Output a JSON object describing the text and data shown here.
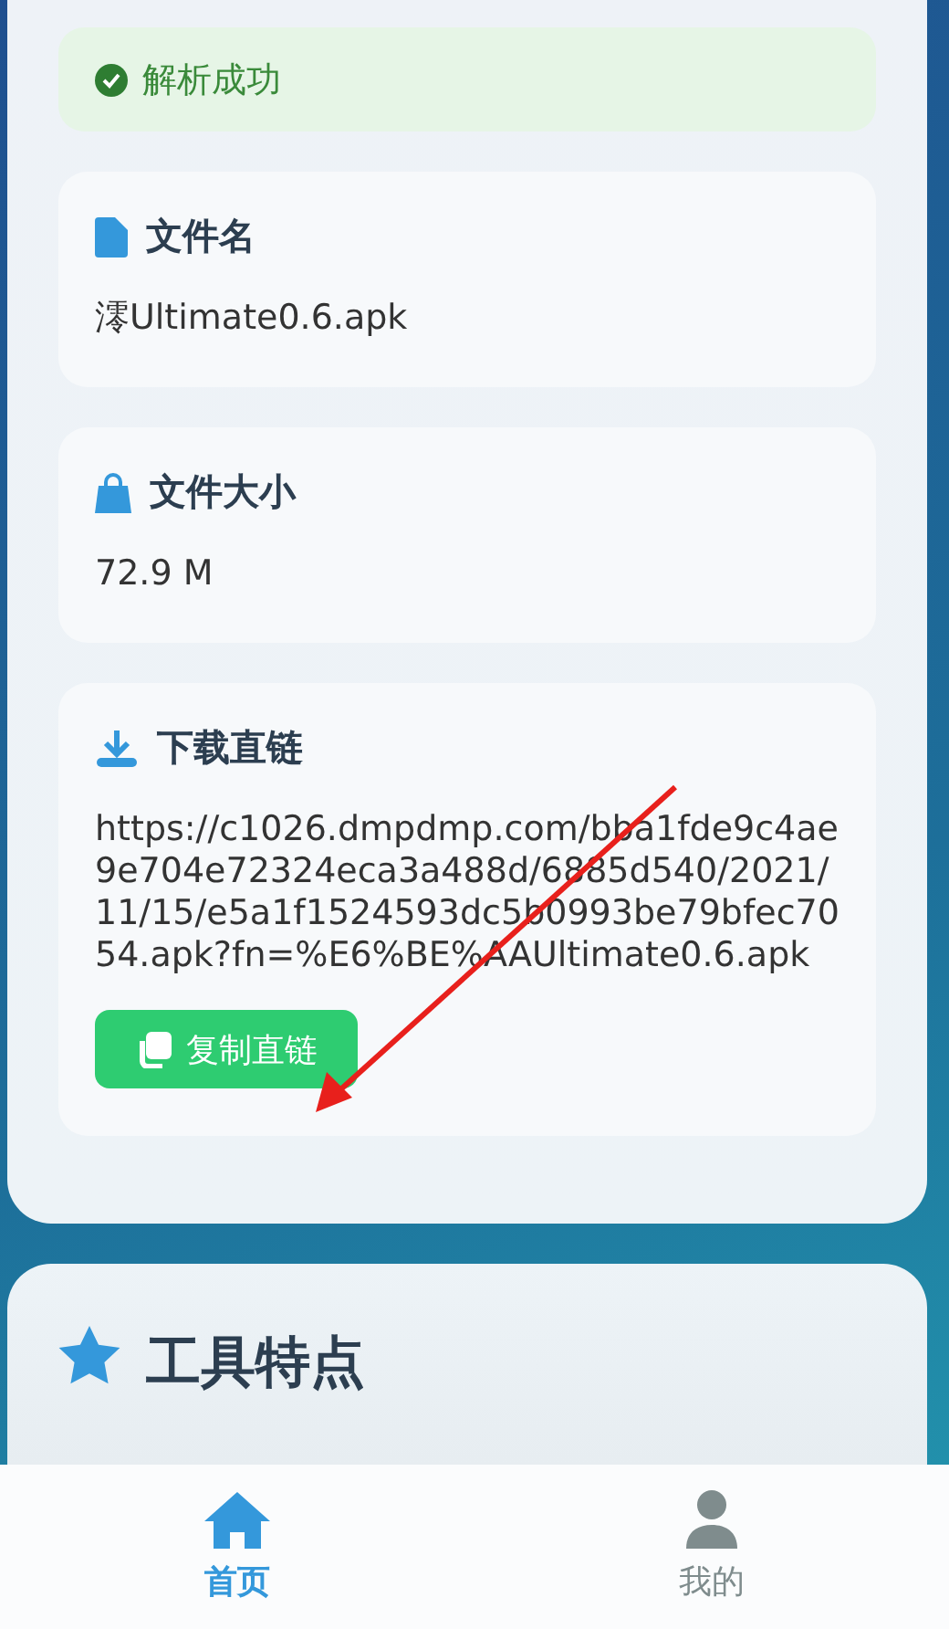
{
  "status": {
    "text": "解析成功"
  },
  "cards": [
    {
      "kind": "file",
      "title": "文件名",
      "value": "澪Ultimate0.6.apk"
    },
    {
      "kind": "size",
      "title": "文件大小",
      "value": "72.9 M"
    },
    {
      "kind": "download",
      "title": "下载直链",
      "value": "https://c1026.dmpdmp.com/bba1fde9c4ae9e704e72324eca3a488d/6885d540/2021/11/15/e5a1f1524593dc5b0993be79bfec7054.apk?fn=%E6%BE%AAUltimate0.6.apk",
      "button": "复制直链"
    }
  ],
  "features": {
    "title": "工具特点"
  },
  "nav": [
    {
      "kind": "home",
      "label": "首页",
      "selected": true
    },
    {
      "kind": "user",
      "label": "我的",
      "selected": false
    }
  ]
}
